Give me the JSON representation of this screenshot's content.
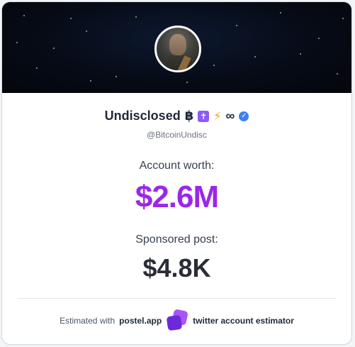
{
  "profile": {
    "display_name": "Undisclosed",
    "emoji_bitcoin": "฿",
    "emoji_cross": "✝",
    "emoji_bolt": "⚡",
    "emoji_infinity": "∞",
    "verified_mark": "✓",
    "handle": "@BitcoinUndisc"
  },
  "stats": {
    "worth_label": "Account worth:",
    "worth_value": "$2.6M",
    "post_label": "Sponsored post:",
    "post_value": "$4.8K"
  },
  "footer": {
    "prefix": "Estimated with",
    "brand": "postel.app",
    "suffix": "twitter account estimator"
  },
  "colors": {
    "worth_accent": "#9b27e8",
    "verified_badge": "#3b82f6",
    "logo_primary": "#6d28d9"
  }
}
